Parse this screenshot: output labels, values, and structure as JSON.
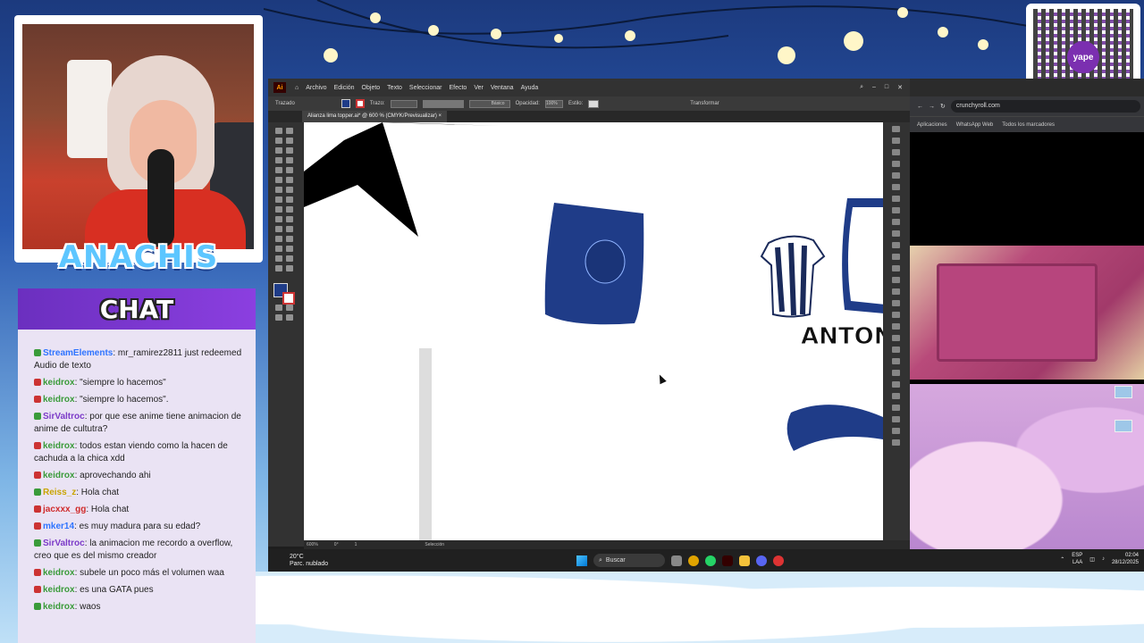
{
  "overlay": {
    "streamer_name": "ANACHIS",
    "chat_title": "CHAT",
    "qr_logo": "yape"
  },
  "chat": [
    {
      "user": "StreamElements",
      "user_color": "#2f74ff",
      "text": ": mr_ramirez2811 just redeemed Audio de texto"
    },
    {
      "user": "keidrox",
      "user_color": "#3a9b3a",
      "text": ": \"siempre lo hacemos\""
    },
    {
      "user": "keidrox",
      "user_color": "#3a9b3a",
      "text": ": \"siempre lo hacemos\"."
    },
    {
      "user": "SirValtroc",
      "user_color": "#7c3bc8",
      "text": ": por que ese anime tiene animacion de anime de cultutra?"
    },
    {
      "user": "keidrox",
      "user_color": "#3a9b3a",
      "text": ": todos estan viendo como la hacen de cachuda a la chica xdd"
    },
    {
      "user": "keidrox",
      "user_color": "#3a9b3a",
      "text": ": aprovechando ahi"
    },
    {
      "user": "Reiss_z",
      "user_color": "#c9a400",
      "text": ": Hola chat"
    },
    {
      "user": "jacxxx_gg",
      "user_color": "#d02b2b",
      "text": ": Hola chat"
    },
    {
      "user": "mker14",
      "user_color": "#2f74ff",
      "text": ": es muy madura para su edad?"
    },
    {
      "user": "SirValtroc",
      "user_color": "#7c3bc8",
      "text": ": la animacion me recordo a overflow, creo que es del mismo creador"
    },
    {
      "user": "keidrox",
      "user_color": "#3a9b3a",
      "text": ": subele un poco más el volumen waa"
    },
    {
      "user": "keidrox",
      "user_color": "#3a9b3a",
      "text": ": es una GATA pues"
    },
    {
      "user": "keidrox",
      "user_color": "#3a9b3a",
      "text": ": waos"
    }
  ],
  "illustrator": {
    "menu": [
      "Archivo",
      "Edición",
      "Objeto",
      "Texto",
      "Seleccionar",
      "Efecto",
      "Ver",
      "Ventana",
      "Ayuda"
    ],
    "control_label": "Trazado",
    "stroke_label": "Trazo:",
    "stroke_style": "Básico",
    "opacity_label": "Opacidad:",
    "opacity_value": "100%",
    "style_label": "Estilo:",
    "transform_label": "Transformar",
    "document_tab": "Alianza lima topper.ai* @ 600 % (CMYK/Previsualizar)",
    "status_zoom": "600%",
    "status_rotation": "0°",
    "status_artboard": "1",
    "status_tool": "Selección",
    "canvas_text": "ANTON"
  },
  "browser": {
    "url": "crunchyroll.com",
    "bookmarks": [
      "Aplicaciones",
      "WhatsApp Web",
      "Todos los marcadores"
    ]
  },
  "taskbar": {
    "temperature": "20°C",
    "weather": "Parc. nublado",
    "search_placeholder": "Buscar",
    "language": "ESP",
    "language_sub": "LAA",
    "time": "02:04",
    "date": "28/12/2025"
  },
  "colors": {
    "navy": "#1f3c88",
    "chat_header": "#6b2fbf",
    "ai_orange": "#ff9a00"
  }
}
